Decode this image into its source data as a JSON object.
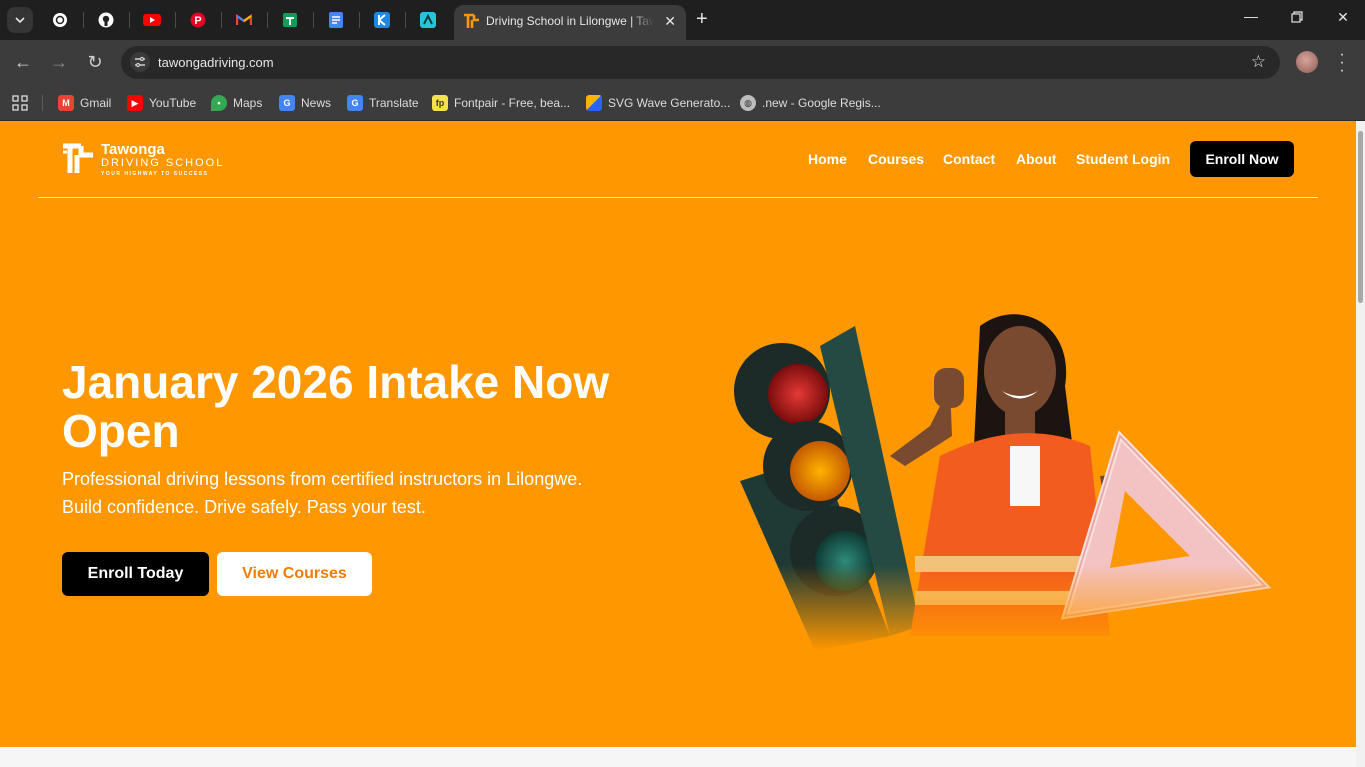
{
  "browser": {
    "active_tab": {
      "title": "Driving School in Lilongwe | Tawonga"
    },
    "url": "tawongadriving.com",
    "pinned_tabs": [
      "chatgpt-icon",
      "github-icon",
      "youtube-icon",
      "pinterest-icon",
      "gmail-icon",
      "sheets-icon",
      "docs-icon",
      "app-icon-blue",
      "app-icon-teal"
    ],
    "bookmarks": [
      {
        "label": "Gmail",
        "icon": "gmail-icon",
        "color": "#ea4335"
      },
      {
        "label": "YouTube",
        "icon": "youtube-icon",
        "color": "#ff0000"
      },
      {
        "label": "Maps",
        "icon": "maps-icon",
        "color": "#34a853"
      },
      {
        "label": "News",
        "icon": "news-icon",
        "color": "#4285f4"
      },
      {
        "label": "Translate",
        "icon": "translate-icon",
        "color": "#4285f4"
      },
      {
        "label": "Fontpair - Free, bea...",
        "icon": "fontpair-icon",
        "color": "#f5e14a"
      },
      {
        "label": "SVG Wave Generato...",
        "icon": "svgwave-icon",
        "color": "#ff5252"
      },
      {
        "label": ".new - Google Regis...",
        "icon": "globe-icon",
        "color": "#bdbdbd"
      }
    ]
  },
  "site": {
    "logo": {
      "brand": "Tawonga",
      "sub": "DRIVING SCHOOL",
      "tagline": "YOUR HIGHWAY TO SUCCESS"
    },
    "nav": [
      "Home",
      "Courses",
      "Contact",
      "About",
      "Student Login"
    ],
    "cta": "Enroll Now",
    "hero": {
      "title": "January 2026 Intake Now Open",
      "subtitle_line1": "Professional driving lessons from certified instructors in Lilongwe.",
      "subtitle_line2": "Build confidence. Drive safely. Pass your test.",
      "primary_button": "Enroll Today",
      "secondary_button": "View Courses"
    },
    "colors": {
      "accent": "#ff9800",
      "button_dark": "#000000",
      "secondary_text": "#ef7d00"
    }
  }
}
